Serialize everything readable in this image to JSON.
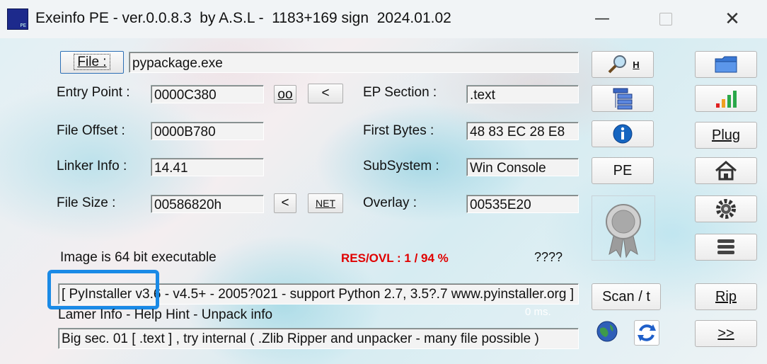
{
  "window": {
    "title": "Exeinfo PE - ver.0.0.8.3  by A.S.L -  1183+169 sign  2024.01.02",
    "minimize_icon": "minimize-icon",
    "maximize_icon": "maximize-icon",
    "close_icon": "close-icon"
  },
  "file": {
    "button_label": "File :",
    "value": "pypackage.exe"
  },
  "fields": {
    "entry_point_label": "Entry Point :",
    "entry_point": "0000C380",
    "oo_label": "oo",
    "lt1_label": "<",
    "ep_section_label": "EP Section :",
    "ep_section": ".text",
    "file_offset_label": "File Offset :",
    "file_offset": "0000B780",
    "first_bytes_label": "First Bytes :",
    "first_bytes": "48 83 EC 28 E8",
    "linker_info_label": "Linker Info :",
    "linker_info": "14.41",
    "subsystem_label": "SubSystem :",
    "subsystem": "Win Console",
    "file_size_label": "File Size :",
    "file_size": "00586820h",
    "lt2_label": "<",
    "net_label": "NET",
    "overlay_label": "Overlay :",
    "overlay": "00535E20"
  },
  "status": {
    "image_info": "Image is 64 bit executable",
    "res_ovl": "RES/OVL : 1 / 94 %",
    "unknown": "????",
    "detection": "[ PyInstaller v3.6 - v4.5+ - 2005?021 - support Python 2.7, 3.5?.7 www.pyinstaller.org ]",
    "lamer_info": "Lamer Info - Help Hint - Unpack info",
    "time": "0 ms.",
    "hint": "Big sec. 01 [ .text ] , try internal ( .Zlib Ripper and unpacker - many file possible )"
  },
  "right_panel": {
    "search_h": "H",
    "pe_label": "PE",
    "scan_label": "Scan / t",
    "plug_label": "Plug",
    "rip_label": "Rip",
    "next_label": ">>"
  },
  "colors": {
    "accent_highlight": "#1a8ae6",
    "res_ovl_red": "#e00000"
  }
}
